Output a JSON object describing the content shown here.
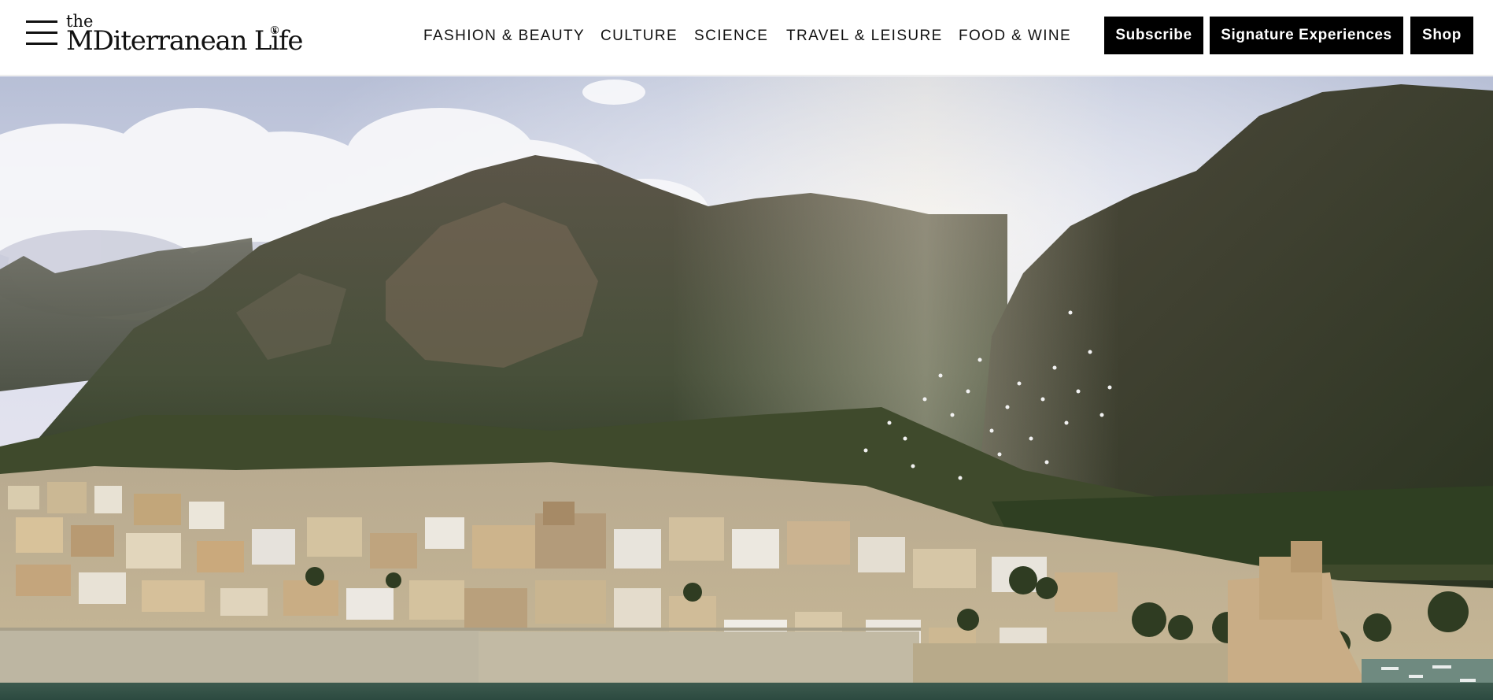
{
  "header": {
    "menu_icon": "hamburger-menu-icon",
    "logo": {
      "small": "the",
      "main": "MDiterranean Life",
      "registered": "®"
    },
    "nav": [
      {
        "label": "FASHION & BEAUTY"
      },
      {
        "label": "CULTURE"
      },
      {
        "label": "SCIENCE"
      },
      {
        "label": "TRAVEL & LEISURE"
      },
      {
        "label": "FOOD & WINE"
      }
    ],
    "buttons": {
      "subscribe": "Subscribe",
      "signature": "Signature Experiences",
      "shop": "Shop"
    }
  },
  "hero": {
    "scene": "coastal-town-mountains-photo"
  },
  "colors": {
    "header_bg": "#ffffff",
    "text": "#111111",
    "button_bg": "#000000",
    "button_text": "#ffffff"
  }
}
